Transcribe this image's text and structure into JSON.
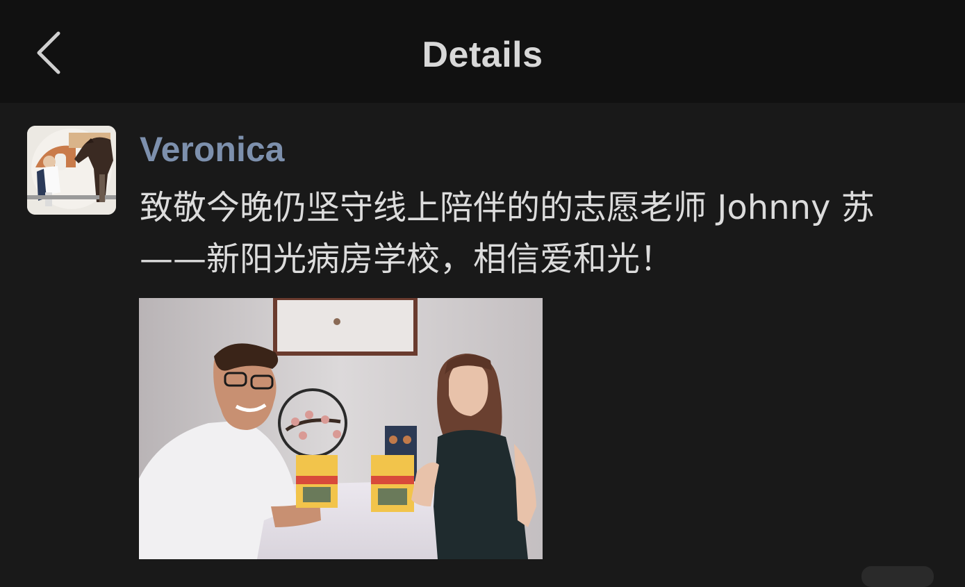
{
  "header": {
    "title": "Details",
    "back_icon": "chevron-left-icon"
  },
  "post": {
    "author": "Veronica",
    "text": "致敬今晚仍坚守线上陪伴的的志愿老师 Johnny 苏 ——新阳光病房学校，相信爱和光！"
  },
  "colors": {
    "header_bg": "#111111",
    "page_bg": "#191919",
    "author_name": "#7d90ad",
    "text": "#dcdcdc"
  }
}
